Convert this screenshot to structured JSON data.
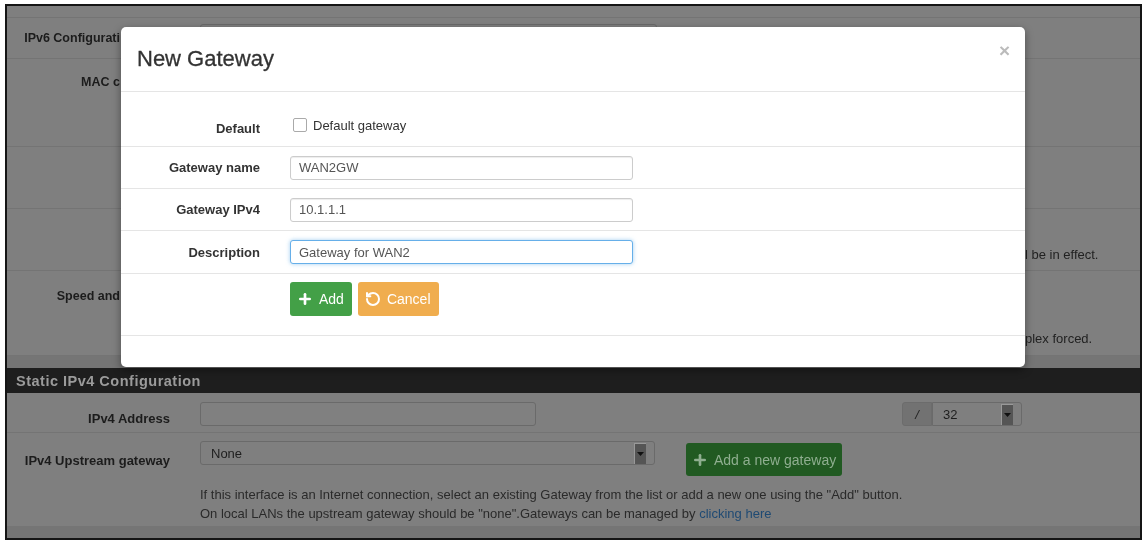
{
  "background_rows": [
    {
      "kind": "select",
      "label": "IPv6 Configurati"
    },
    {
      "kind": "plain",
      "label": "MAC c"
    },
    {
      "kind": "plain"
    },
    {
      "kind": "plain",
      "note": "l be in effect."
    },
    {
      "kind": "plain",
      "label": "Speed and",
      "note": "plex forced."
    }
  ],
  "static_ipv4": {
    "title": "Static IPv4 Configuration",
    "address": {
      "label": "IPv4 Address",
      "separator": "/",
      "mask": "32"
    },
    "gateway": {
      "label": "IPv4 Upstream gateway",
      "value": "None",
      "button": "Add a new gateway"
    },
    "help": {
      "line1": "If this interface is an Internet connection, select an existing Gateway from the list or add a new one using the \"Add\" button.",
      "line2": "On local LANs the upstream gateway should be \"none\".Gateways can be managed by ",
      "link": "clicking here"
    }
  },
  "modal": {
    "title": "New Gateway",
    "close": "×",
    "fields": [
      {
        "kind": "checkbox",
        "label": "Default",
        "text": "Default gateway",
        "checked": false
      },
      {
        "kind": "text",
        "label": "Gateway name",
        "value": "WAN2GW",
        "focused": false
      },
      {
        "kind": "text",
        "label": "Gateway IPv4",
        "value": "10.1.1.1",
        "focused": false
      },
      {
        "kind": "text",
        "label": "Description",
        "value": "Gateway for WAN2",
        "focused": true
      }
    ],
    "buttons": [
      {
        "kind": "add",
        "label": "Add"
      },
      {
        "kind": "cancel",
        "label": "Cancel"
      }
    ]
  }
}
